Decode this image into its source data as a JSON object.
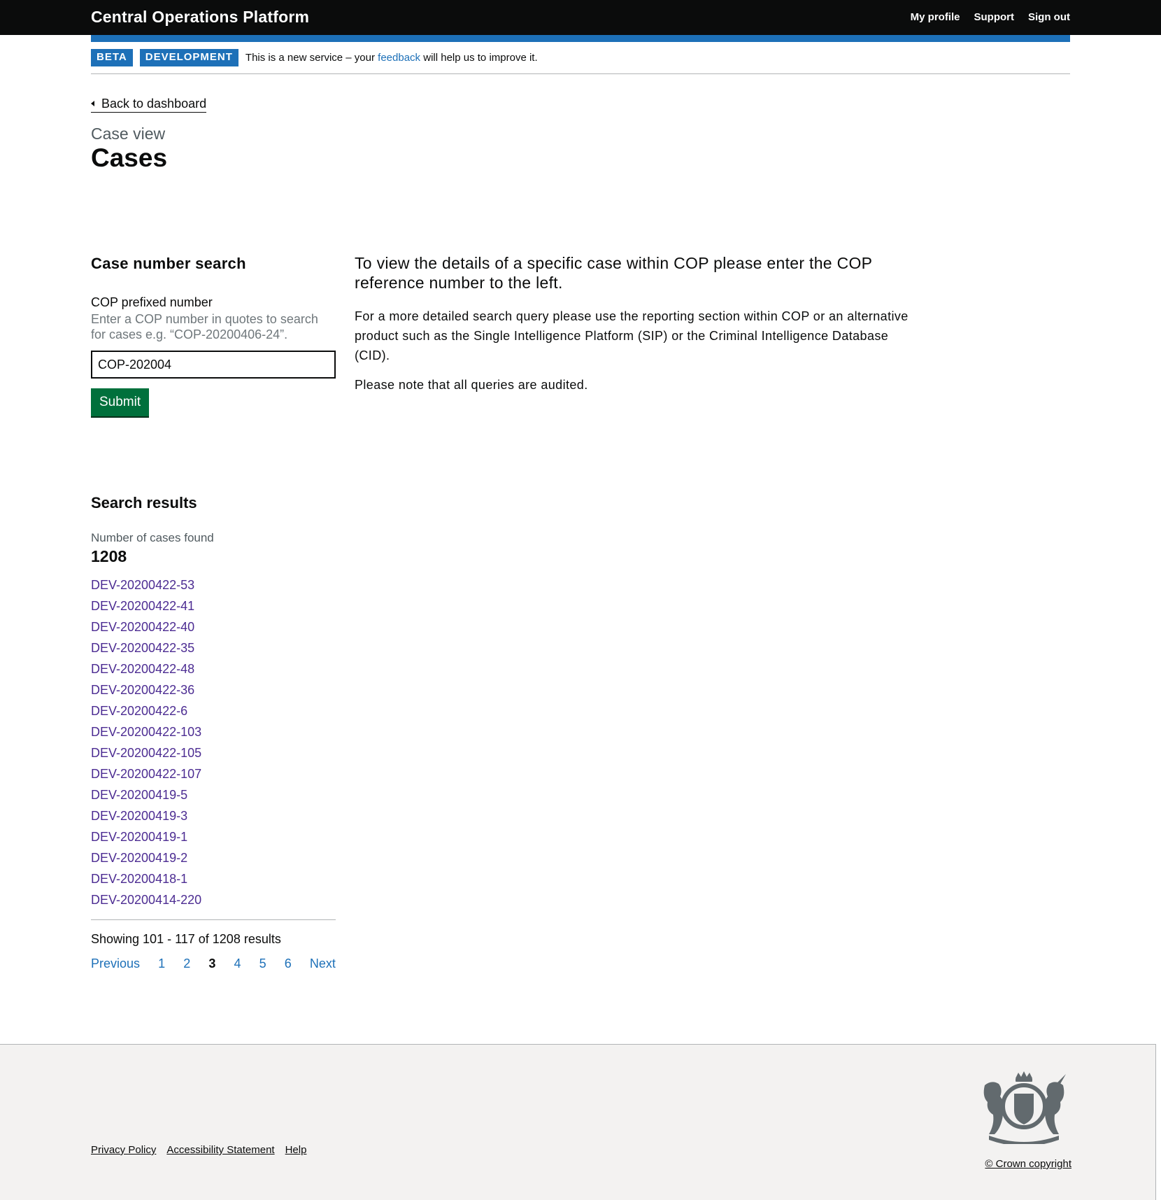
{
  "header": {
    "title": "Central Operations Platform",
    "nav": [
      "My profile",
      "Support",
      "Sign out"
    ]
  },
  "phase_banner": {
    "tags": [
      "BETA",
      "DEVELOPMENT"
    ],
    "text_before": "This is a new service – your ",
    "link": "feedback",
    "text_after": " will help us to improve it."
  },
  "back_link": "Back to dashboard",
  "caption": "Case view",
  "page_title": "Cases",
  "search": {
    "heading": "Case number search",
    "label": "COP prefixed number",
    "hint": "Enter a COP number in quotes to search for cases e.g. “COP-20200406-24”.",
    "value": "COP-202004",
    "submit": "Submit"
  },
  "info": {
    "lead": "To view the details of a specific case within COP please enter the COP reference number to the left.",
    "para1": "For a more detailed search query please use the reporting section within COP or an alternative product such as the Single Intelligence Platform (SIP) or the Criminal Intelligence Database (CID).",
    "para2": "Please note that all queries are audited."
  },
  "results": {
    "heading": "Search results",
    "count_label": "Number of cases found",
    "count": "1208",
    "cases": [
      "DEV-20200422-53",
      "DEV-20200422-41",
      "DEV-20200422-40",
      "DEV-20200422-35",
      "DEV-20200422-48",
      "DEV-20200422-36",
      "DEV-20200422-6",
      "DEV-20200422-103",
      "DEV-20200422-105",
      "DEV-20200422-107",
      "DEV-20200419-5",
      "DEV-20200419-3",
      "DEV-20200419-1",
      "DEV-20200419-2",
      "DEV-20200418-1",
      "DEV-20200414-220"
    ],
    "showing": "Showing 101 - 117 of 1208 results",
    "pagination": {
      "previous": "Previous",
      "pages": [
        "1",
        "2",
        "3",
        "4",
        "5",
        "6"
      ],
      "current": "3",
      "next": "Next"
    }
  },
  "footer": {
    "links": [
      "Privacy Policy",
      "Accessibility Statement",
      "Help"
    ],
    "copyright": "© Crown copyright"
  },
  "colors": {
    "header_bg": "#0b0c0c",
    "accent_blue": "#1d70b8",
    "submit_green": "#00703c",
    "visited_link": "#4c2c92",
    "footer_bg": "#f3f2f1"
  },
  "icons": [
    "chevron-left-icon",
    "royal-coat-of-arms-icon"
  ]
}
